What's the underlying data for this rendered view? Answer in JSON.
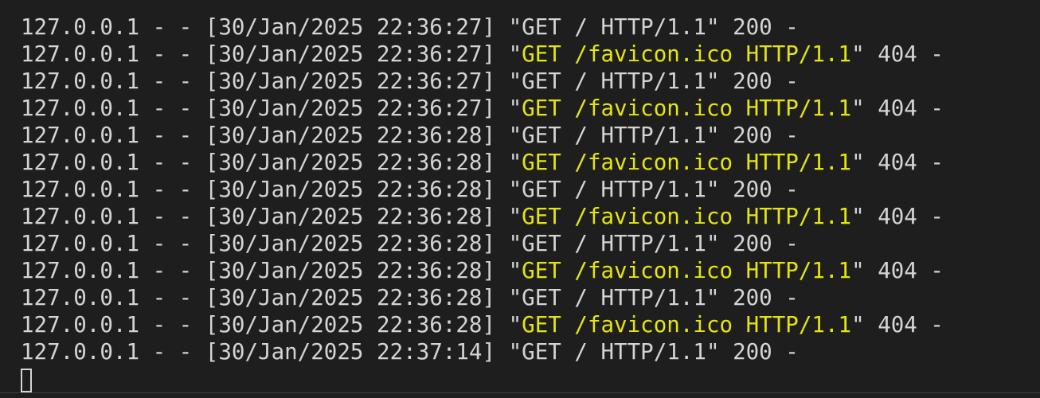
{
  "terminal": {
    "colors": {
      "background": "#1e1e1e",
      "text": "#d4d4d4",
      "warning": "#e5e510"
    },
    "lines": [
      {
        "prefix": "127.0.0.1 - - [30/Jan/2025 22:36:27] ",
        "request": "GET / HTTP/1.1",
        "status": " 200 -",
        "warn": false
      },
      {
        "prefix": "127.0.0.1 - - [30/Jan/2025 22:36:27] ",
        "request": "GET /favicon.ico HTTP/1.1",
        "status": " 404 -",
        "warn": true
      },
      {
        "prefix": "127.0.0.1 - - [30/Jan/2025 22:36:27] ",
        "request": "GET / HTTP/1.1",
        "status": " 200 -",
        "warn": false
      },
      {
        "prefix": "127.0.0.1 - - [30/Jan/2025 22:36:27] ",
        "request": "GET /favicon.ico HTTP/1.1",
        "status": " 404 -",
        "warn": true
      },
      {
        "prefix": "127.0.0.1 - - [30/Jan/2025 22:36:28] ",
        "request": "GET / HTTP/1.1",
        "status": " 200 -",
        "warn": false
      },
      {
        "prefix": "127.0.0.1 - - [30/Jan/2025 22:36:28] ",
        "request": "GET /favicon.ico HTTP/1.1",
        "status": " 404 -",
        "warn": true
      },
      {
        "prefix": "127.0.0.1 - - [30/Jan/2025 22:36:28] ",
        "request": "GET / HTTP/1.1",
        "status": " 200 -",
        "warn": false
      },
      {
        "prefix": "127.0.0.1 - - [30/Jan/2025 22:36:28] ",
        "request": "GET /favicon.ico HTTP/1.1",
        "status": " 404 -",
        "warn": true
      },
      {
        "prefix": "127.0.0.1 - - [30/Jan/2025 22:36:28] ",
        "request": "GET / HTTP/1.1",
        "status": " 200 -",
        "warn": false
      },
      {
        "prefix": "127.0.0.1 - - [30/Jan/2025 22:36:28] ",
        "request": "GET /favicon.ico HTTP/1.1",
        "status": " 404 -",
        "warn": true
      },
      {
        "prefix": "127.0.0.1 - - [30/Jan/2025 22:36:28] ",
        "request": "GET / HTTP/1.1",
        "status": " 200 -",
        "warn": false
      },
      {
        "prefix": "127.0.0.1 - - [30/Jan/2025 22:36:28] ",
        "request": "GET /favicon.ico HTTP/1.1",
        "status": " 404 -",
        "warn": true
      },
      {
        "prefix": "127.0.0.1 - - [30/Jan/2025 22:37:14] ",
        "request": "GET / HTTP/1.1",
        "status": " 200 -",
        "warn": false
      }
    ],
    "cursor_icon": "block-cursor-icon"
  }
}
